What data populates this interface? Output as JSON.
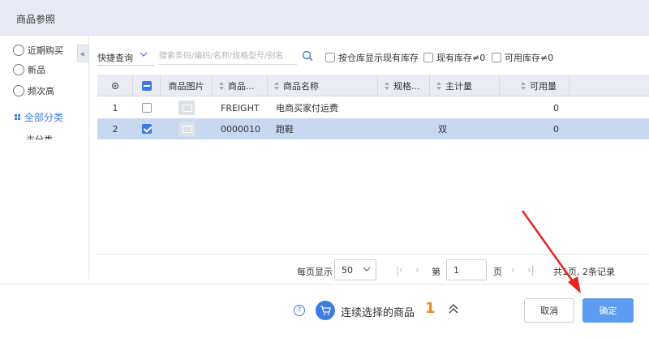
{
  "window": {
    "title": "商品参照"
  },
  "sidebar": {
    "items": [
      {
        "label": "近期购买",
        "icon": "bag-icon"
      },
      {
        "label": "新品",
        "icon": "new-icon"
      },
      {
        "label": "频次高",
        "icon": "star-icon"
      }
    ],
    "category_label": "全部分类",
    "subcategory_label": "未分类",
    "collapse_icon": "double-chevron-left-icon"
  },
  "filter": {
    "quick_label": "快捷查询",
    "search_placeholder": "搜索条码/编码/名称/规格型号/别名",
    "checkboxes": [
      {
        "label": "按仓库显示现有库存",
        "checked": false
      },
      {
        "label": "现有库存≠0",
        "checked": false
      },
      {
        "label": "可用库存≠0",
        "checked": false
      }
    ]
  },
  "table": {
    "columns": [
      "商品图片",
      "商品...",
      "商品名称",
      "规格...",
      "主计量",
      "可用量"
    ],
    "rows": [
      {
        "index": "1",
        "checked": false,
        "code": "FREIGHT",
        "name": "电商买家付运费",
        "spec": "",
        "unit": "",
        "available": "0"
      },
      {
        "index": "2",
        "checked": true,
        "code": "0000010",
        "name": "跑鞋",
        "spec": "",
        "unit": "双",
        "available": "0"
      }
    ]
  },
  "pager": {
    "per_page_label": "每页显示",
    "page_size": "50",
    "page_prefix": "第",
    "current_page": "1",
    "page_suffix": "页",
    "summary": "共1页, 2条记录"
  },
  "footer": {
    "continue_label": "连续选择的商品",
    "selected_count": "1",
    "cancel_label": "取消",
    "ok_label": "确定"
  },
  "colors": {
    "accent": "#3d7be0",
    "selected_row": "#c7d8f1",
    "count": "#f08a1e",
    "annotation_arrow": "#e52420"
  }
}
